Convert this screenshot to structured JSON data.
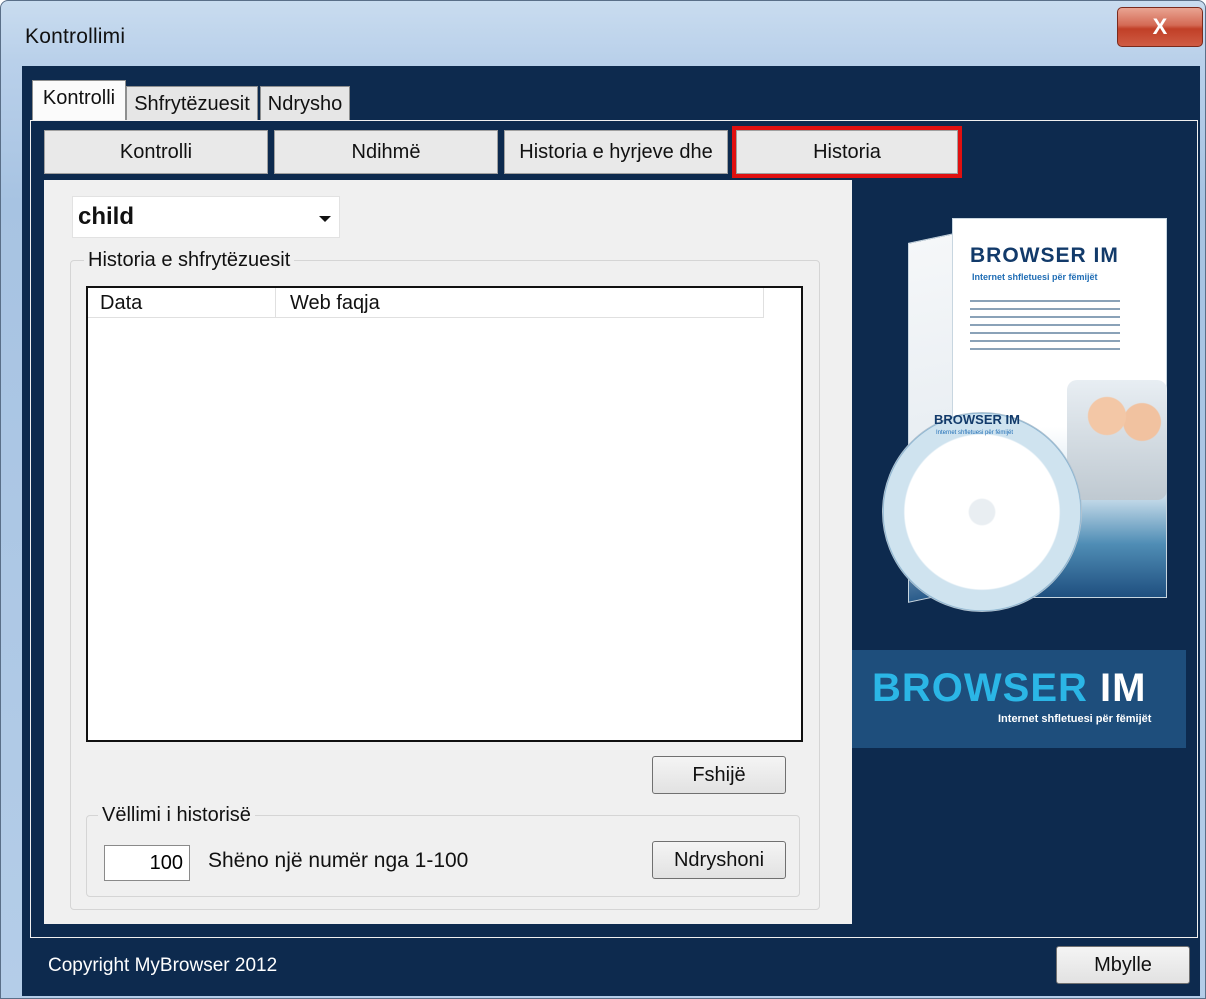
{
  "window": {
    "title": "Kontrollimi",
    "close_glyph": "X"
  },
  "tabs": [
    {
      "label": "Kontrolli"
    },
    {
      "label": "Shfrytëzuesit"
    },
    {
      "label": "Ndrysho"
    }
  ],
  "subtabs": [
    {
      "label": "Kontrolli"
    },
    {
      "label": "Ndihmë"
    },
    {
      "label": "Historia e hyrjeve dhe"
    },
    {
      "label": "Historia"
    }
  ],
  "user_select": {
    "value": "child"
  },
  "history_group": {
    "label": "Historia e shfrytëzuesit",
    "columns": [
      "Data",
      "Web faqja"
    ],
    "rows": []
  },
  "buttons": {
    "delete": "Fshijë",
    "change": "Ndryshoni",
    "close": "Mbylle"
  },
  "volume_group": {
    "label": "Vëllimi i historisë",
    "value": "100",
    "hint": "Shëno një numër nga 1-100"
  },
  "footer": {
    "copyright": "Copyright MyBrowser 2012"
  },
  "product_art": {
    "box_title": "BROWSER IM",
    "box_subtitle": "Internet shfletuesi për fëmijët",
    "cd_title": "BROWSER IM",
    "cd_subtitle": "Internet shfletuesi për fëmijët",
    "banner_title_part1": "BROWSER",
    "banner_title_part2": "IM",
    "banner_subtitle": "Internet shfletuesi për fëmijët"
  },
  "colors": {
    "panel_navy": "#0d2a4e",
    "highlight_red": "#e01010",
    "banner_blue": "#2bb6e6"
  }
}
